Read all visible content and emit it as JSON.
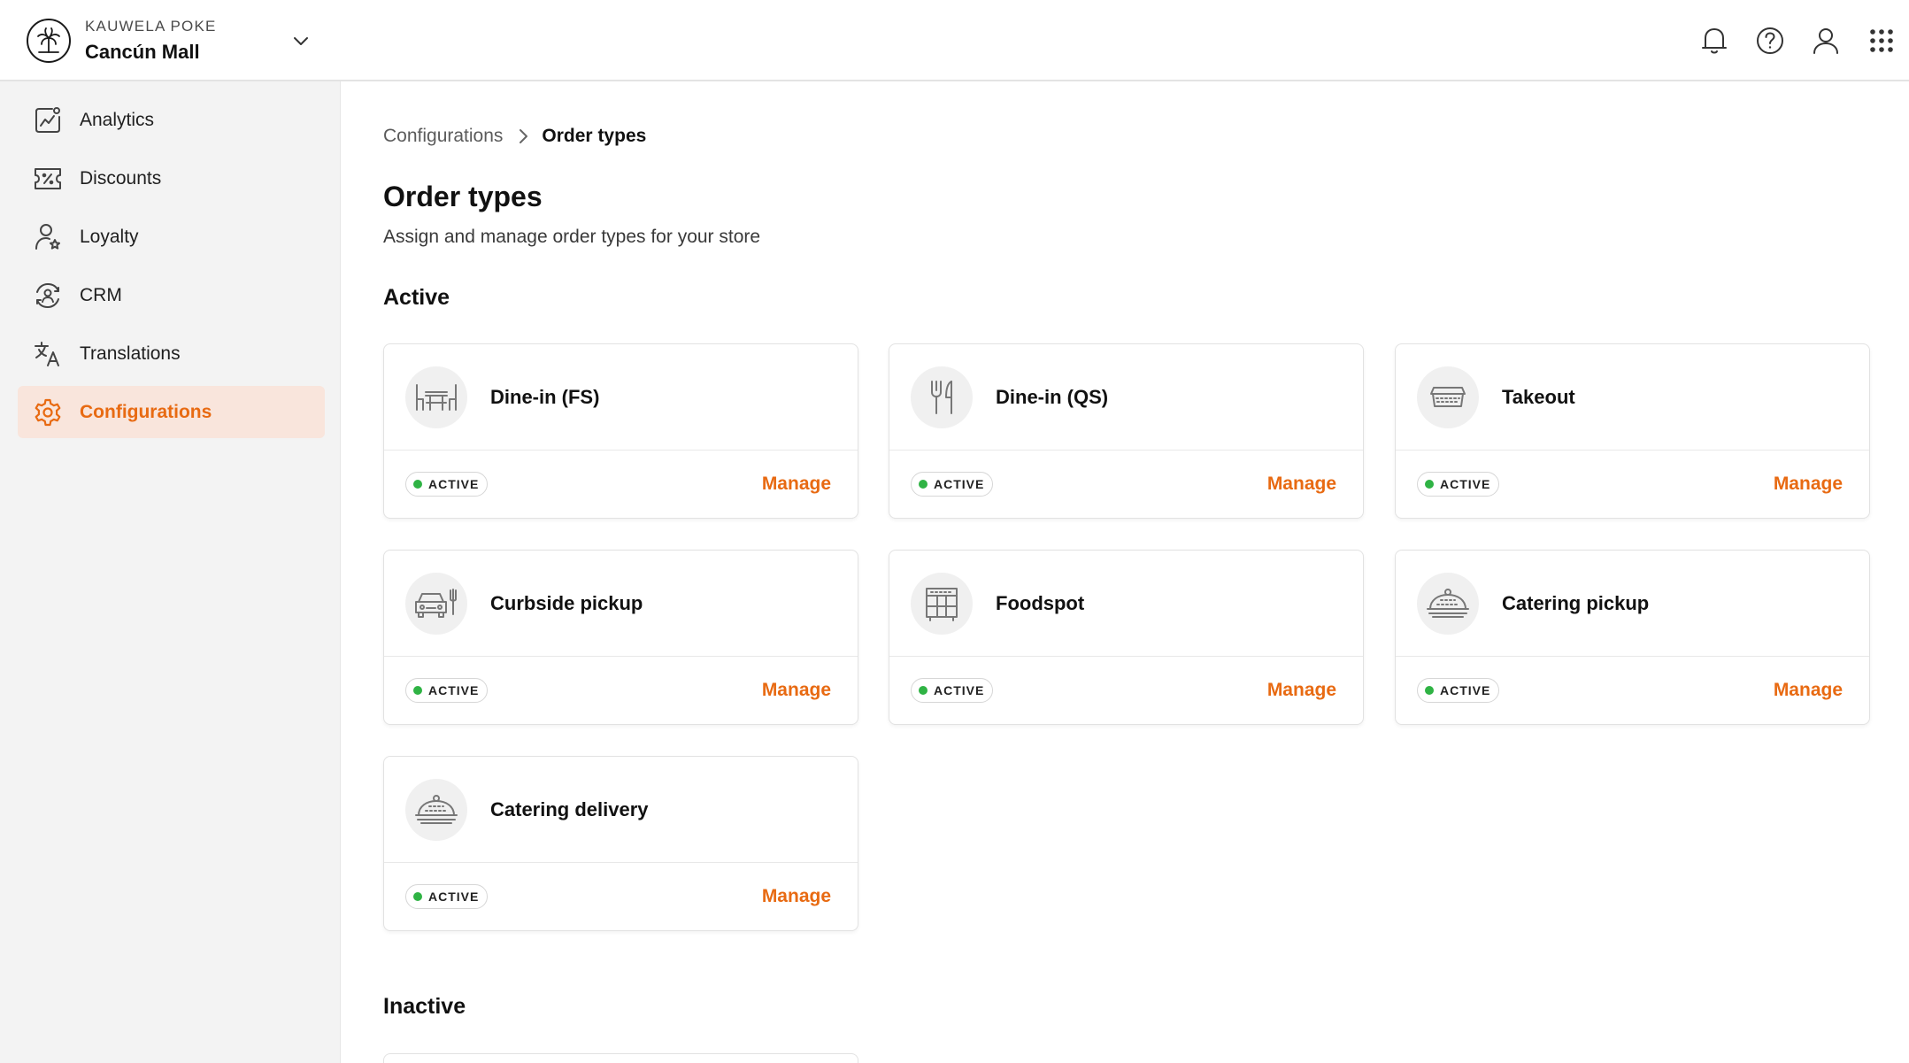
{
  "header": {
    "brand": "KAUWELA POKE",
    "store": "Cancún Mall",
    "icons": [
      "bell-icon",
      "help-icon",
      "user-icon",
      "apps-grid-icon"
    ]
  },
  "sidebar": {
    "items": [
      {
        "label": "Analytics",
        "icon": "analytics-icon"
      },
      {
        "label": "Discounts",
        "icon": "discount-ticket-icon"
      },
      {
        "label": "Loyalty",
        "icon": "loyalty-user-star-icon"
      },
      {
        "label": "CRM",
        "icon": "crm-icon"
      },
      {
        "label": "Translations",
        "icon": "translate-icon"
      },
      {
        "label": "Configurations",
        "icon": "gear-icon",
        "active": true
      }
    ]
  },
  "breadcrumb": {
    "parent": "Configurations",
    "current": "Order types"
  },
  "page": {
    "title": "Order types",
    "subtitle": "Assign and manage order types for your store"
  },
  "sections": {
    "active": "Active",
    "inactive": "Inactive"
  },
  "cards": [
    {
      "name": "Dine-in (FS)",
      "status": "ACTIVE",
      "action": "Manage",
      "icon": "table-chairs-icon"
    },
    {
      "name": "Dine-in (QS)",
      "status": "ACTIVE",
      "action": "Manage",
      "icon": "fork-knife-icon"
    },
    {
      "name": "Takeout",
      "status": "ACTIVE",
      "action": "Manage",
      "icon": "takeout-container-icon"
    },
    {
      "name": "Curbside pickup",
      "status": "ACTIVE",
      "action": "Manage",
      "icon": "car-icon"
    },
    {
      "name": "Foodspot",
      "status": "ACTIVE",
      "action": "Manage",
      "icon": "food-locker-icon"
    },
    {
      "name": "Catering pickup",
      "status": "ACTIVE",
      "action": "Manage",
      "icon": "cloche-icon"
    },
    {
      "name": "Catering delivery",
      "status": "ACTIVE",
      "action": "Manage",
      "icon": "cloche-icon"
    }
  ],
  "colors": {
    "accent": "#e86a12",
    "active_dot": "#2fb344",
    "active_nav_bg": "#f9e5dc",
    "sidebar_bg": "#f3f3f3"
  }
}
